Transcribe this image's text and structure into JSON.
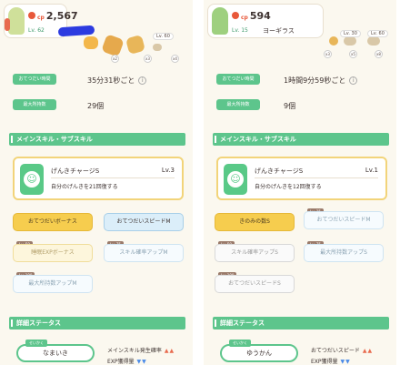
{
  "colors": {
    "accent_green": "#5dc58c",
    "main_skill_gold": "#f6cd4e",
    "sub_skill_blue": "#dbeef9",
    "cp_red": "#e8583a"
  },
  "left": {
    "cp": "2,567",
    "level": "Lv. 62",
    "cp_unit": "cp",
    "ingredient_level": "Lv. 60",
    "ingredient_counts": [
      "x2",
      "x3",
      "x4"
    ],
    "helper_time_label": "おてつだい時間",
    "helper_time_value": "35分31秒ごと",
    "max_carry_label": "最大所持数",
    "max_carry_value": "29個",
    "section_skills": "メインスキル・サブスキル",
    "skill_name": "げんきチャージS",
    "skill_lv": "Lv.3",
    "skill_desc": "自分のげんきを21回復する",
    "subs": [
      {
        "label": "おてつだいボーナス",
        "level": ""
      },
      {
        "label": "おてつだいスピードM",
        "level": ""
      },
      {
        "label": "睡眠EXPボーナス",
        "level": "Lv. 50"
      },
      {
        "label": "スキル確率アップM",
        "level": "Lv. 75"
      },
      {
        "label": "最大所持数アップM",
        "level": "Lv. 100"
      }
    ],
    "section_status": "詳細ステータス",
    "nature_tag": "せいかく",
    "nature": "なまいき",
    "effects": [
      {
        "label": "メインスキル発生確率",
        "dir": "▲▲"
      },
      {
        "label": "EXP獲得量",
        "dir": "▼▼"
      }
    ]
  },
  "right": {
    "cp": "594",
    "level": "Lv. 15",
    "name": "ヨーギラス",
    "cp_unit": "cp",
    "ingredient_levels": [
      "Lv. 30",
      "Lv. 60"
    ],
    "ingredient_counts": [
      "x3",
      "x5",
      "x8"
    ],
    "helper_time_label": "おてつだい時間",
    "helper_time_value": "1時間9分59秒ごと",
    "max_carry_label": "最大所持数",
    "max_carry_value": "9個",
    "section_skills": "メインスキル・サブスキル",
    "skill_name": "げんきチャージS",
    "skill_lv": "Lv.1",
    "skill_desc": "自分のげんきを12回復する",
    "subs": [
      {
        "label": "きのみの数S",
        "level": ""
      },
      {
        "label": "おてつだいスピードM",
        "level": "Lv. 25"
      },
      {
        "label": "スキル確率アップS",
        "level": "Lv. 50"
      },
      {
        "label": "最大所持数アップS",
        "level": "Lv. 75"
      },
      {
        "label": "おてつだいスピードS",
        "level": "Lv. 100"
      }
    ],
    "section_status": "詳細ステータス",
    "nature_tag": "せいかく",
    "nature": "ゆうかん",
    "effects": [
      {
        "label": "おてつだいスピード",
        "dir": "▲▲"
      },
      {
        "label": "EXP獲得量",
        "dir": "▼▼"
      }
    ]
  }
}
